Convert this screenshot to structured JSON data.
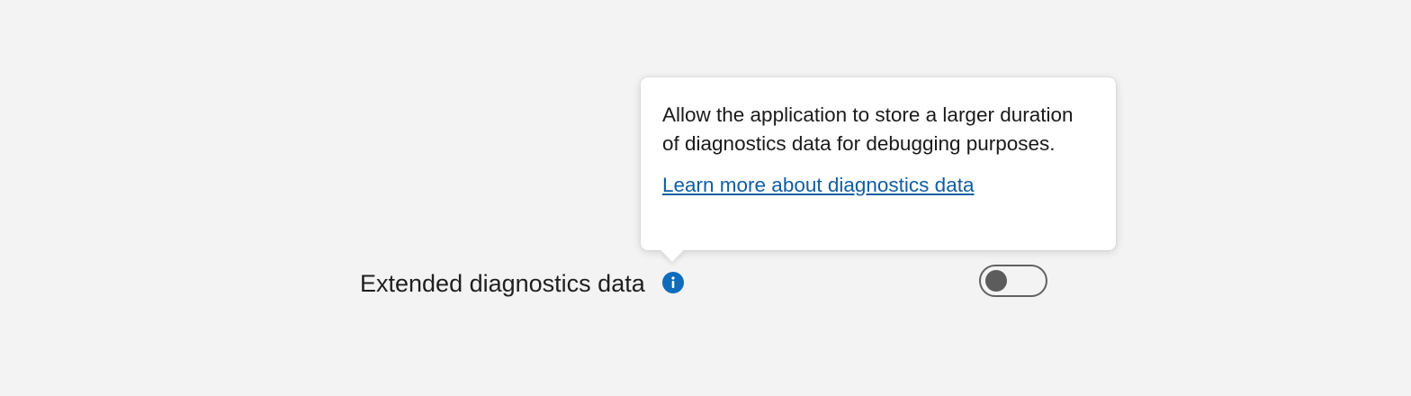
{
  "setting": {
    "label": "Extended diagnostics data",
    "info_icon": "info-icon",
    "toggle_state": "off"
  },
  "tooltip": {
    "text": "Allow the application to store a larger duration of diagnostics data for debugging purposes.",
    "link_text": "Learn more about diagnostics data"
  },
  "colors": {
    "background": "#f3f3f3",
    "accent": "#0f6cbd",
    "link": "#115ea3",
    "toggle_off": "#616161"
  }
}
